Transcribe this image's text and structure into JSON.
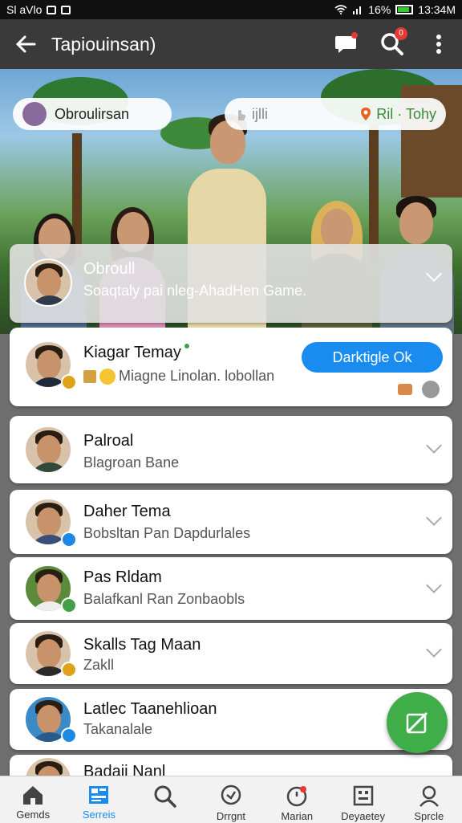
{
  "status": {
    "left": "Sl aVlo",
    "battery": "16%",
    "time": "13:34M"
  },
  "appbar": {
    "title": "Tapiouinsan)",
    "back_icon": "arrow-left-icon",
    "actions": [
      "chat-bubble-icon",
      "search-icon",
      "more-vert-icon"
    ],
    "search_badge": "0"
  },
  "hero": {
    "pill_left": "Obroulirsan",
    "pill_right_hint": "ijlli",
    "pill_right_action": "Ril · Tohy"
  },
  "featured": {
    "name": "Obroull",
    "subtitle": "Soaqtaly pai nleg-AhadHen Game."
  },
  "highlight": {
    "name": "Kiagar Temay",
    "subtitle": "Miagne Linolan. lobollan",
    "button": "Darktigle Ok",
    "status_color": "#43a047"
  },
  "contacts": [
    {
      "name": "Palroal",
      "subtitle": "Blagroan Bane",
      "badge": ""
    },
    {
      "name": "Daher Tema",
      "subtitle": "Bobsltan Pan Dapdurlales",
      "badge": "#1e88e5"
    },
    {
      "name": "Pas Rldam",
      "subtitle": "Balafkanl Ran Zonbaobls",
      "badge": "#43a047"
    },
    {
      "name": "Skalls Tag Maan",
      "subtitle": "Zakll",
      "badge": "#e0a21b"
    },
    {
      "name": "Latlec Taanehlioan",
      "subtitle": "Takanalale",
      "badge": "#1e88e5"
    },
    {
      "name": "Badaii Nanl",
      "subtitle": "",
      "badge": ""
    }
  ],
  "bottom_nav": [
    {
      "label": "Gemds",
      "icon": "home-icon"
    },
    {
      "label": "Serreis",
      "icon": "grid-icon",
      "active": true
    },
    {
      "label": "",
      "icon": "search-icon"
    },
    {
      "label": "Drrgnt",
      "icon": "chat-icon"
    },
    {
      "label": "Marian",
      "icon": "timer-icon"
    },
    {
      "label": "Deyaetey",
      "icon": "board-icon"
    },
    {
      "label": "Sprcle",
      "icon": "person-icon"
    }
  ],
  "colors": {
    "accent": "#1a8cf0",
    "fab": "#3fae49",
    "appbar": "#3a3a3a"
  }
}
